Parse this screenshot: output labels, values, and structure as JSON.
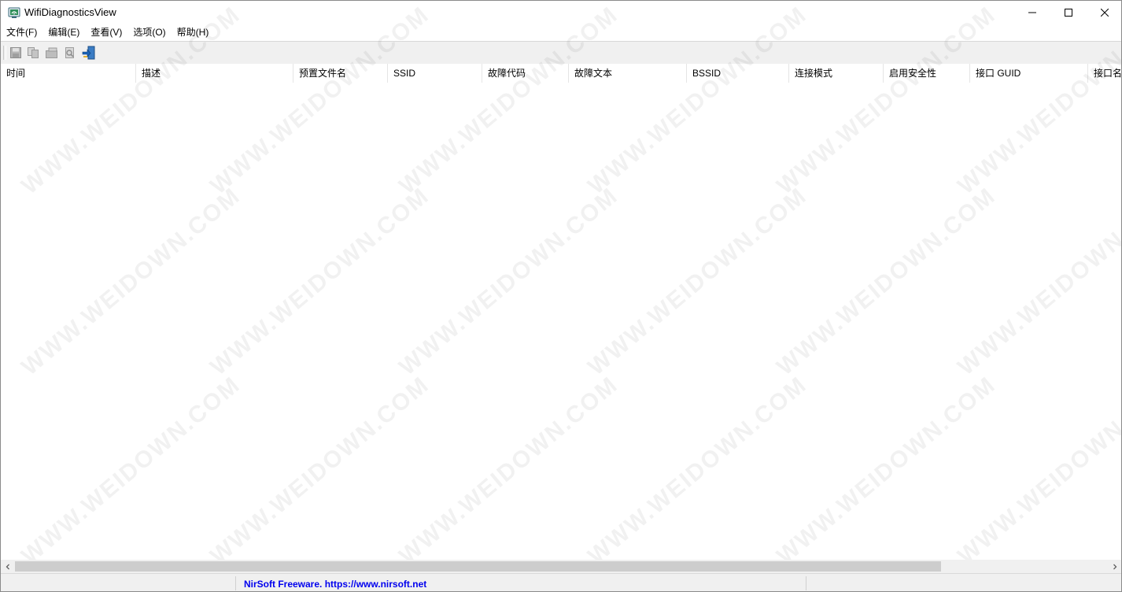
{
  "window": {
    "title": "WifiDiagnosticsView",
    "controls": {
      "minimize": "minimize",
      "maximize": "maximize",
      "close": "close"
    }
  },
  "menu": {
    "items": [
      {
        "label": "文件(F)"
      },
      {
        "label": "编辑(E)"
      },
      {
        "label": "查看(V)"
      },
      {
        "label": "选项(O)"
      },
      {
        "label": "帮助(H)"
      }
    ]
  },
  "toolbar": {
    "buttons": [
      {
        "icon": "save-icon",
        "enabled": false
      },
      {
        "icon": "copy-icon",
        "enabled": false
      },
      {
        "icon": "properties-icon",
        "enabled": false
      },
      {
        "icon": "find-icon",
        "enabled": false
      },
      {
        "icon": "exit-icon",
        "enabled": true
      }
    ]
  },
  "list": {
    "columns": [
      {
        "label": "时间"
      },
      {
        "label": "描述"
      },
      {
        "label": "预置文件名"
      },
      {
        "label": "SSID"
      },
      {
        "label": "故障代码"
      },
      {
        "label": "故障文本"
      },
      {
        "label": "BSSID"
      },
      {
        "label": "连接模式"
      },
      {
        "label": "启用安全性"
      },
      {
        "label": "接口 GUID"
      },
      {
        "label": "接口名"
      }
    ],
    "rows": []
  },
  "watermark": "WWW.WEIDOWN.COM",
  "statusbar": {
    "panel1": "",
    "link": "NirSoft Freeware. https://www.nirsoft.net",
    "panel3": ""
  },
  "colors": {
    "link": "#0000ee",
    "toolbar_bg": "#f0f0f0",
    "scroll_thumb": "#cdcdcd"
  }
}
